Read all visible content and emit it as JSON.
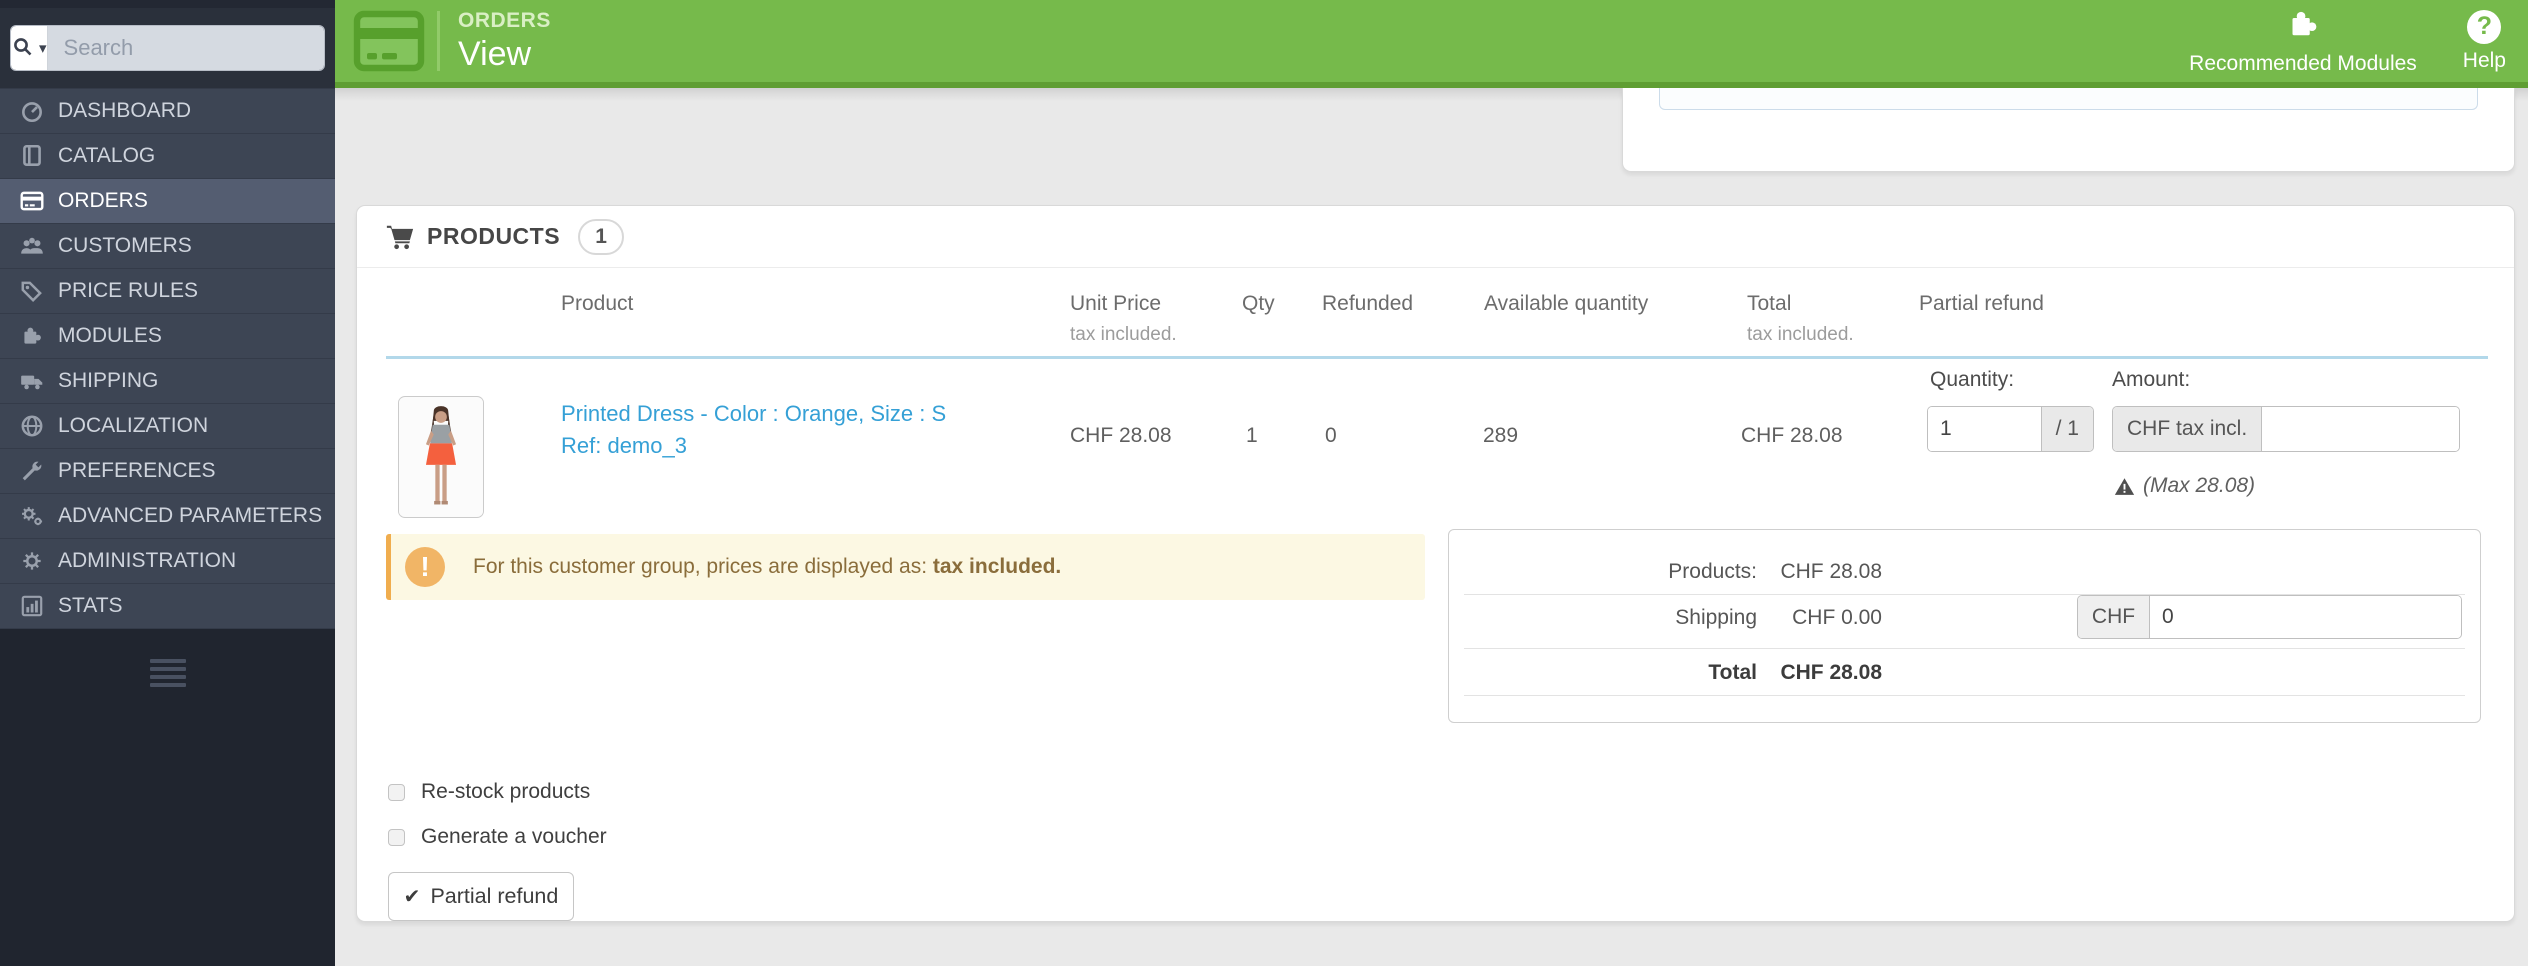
{
  "colors": {
    "green": "#76ba4b",
    "green_dark": "#5f9e33",
    "link": "#35a0d6",
    "sidebar_selected": "#545d71",
    "warn_border": "#f0ad4e",
    "warn_bg": "#fcf8e3",
    "warn_text": "#8a6d3b",
    "underline": "#b2d8ea"
  },
  "sidebar": {
    "search_placeholder": "Search",
    "items": [
      {
        "label": "DASHBOARD"
      },
      {
        "label": "CATALOG"
      },
      {
        "label": "ORDERS"
      },
      {
        "label": "CUSTOMERS"
      },
      {
        "label": "PRICE RULES"
      },
      {
        "label": "MODULES"
      },
      {
        "label": "SHIPPING"
      },
      {
        "label": "LOCALIZATION"
      },
      {
        "label": "PREFERENCES"
      },
      {
        "label": "ADVANCED PARAMETERS"
      },
      {
        "label": "ADMINISTRATION"
      },
      {
        "label": "STATS"
      }
    ]
  },
  "header": {
    "breadcrumb": "ORDERS",
    "title": "View",
    "actions": {
      "recommended_modules": "Recommended Modules",
      "help": "Help",
      "help_glyph": "?"
    }
  },
  "panel": {
    "title": "PRODUCTS",
    "count": "1",
    "table": {
      "headers": {
        "product": "Product",
        "unit_price": "Unit Price",
        "unit_price_note": "tax included.",
        "qty": "Qty",
        "refunded": "Refunded",
        "available": "Available quantity",
        "total": "Total",
        "total_note": "tax included.",
        "partial_refund": "Partial refund"
      },
      "row": {
        "name": "Printed Dress - Color : Orange, Size : S",
        "ref": "Ref: demo_3",
        "unit_price": "CHF 28.08",
        "qty": "1",
        "refunded": "0",
        "available": "289",
        "total": "CHF 28.08"
      }
    },
    "partial_refund": {
      "quantity_label": "Quantity:",
      "quantity_value": "1",
      "quantity_max": "/ 1",
      "amount_label": "Amount:",
      "amount_addon": "CHF tax incl.",
      "amount_value": "",
      "max_note": "(Max 28.08)"
    },
    "alert": {
      "prefix": "For this customer group, prices are displayed as: ",
      "bold": "tax included.",
      "icon_glyph": "!"
    },
    "totals": {
      "products_label": "Products:",
      "products_value": "CHF 28.08",
      "shipping_label": "Shipping",
      "shipping_value": "CHF 0.00",
      "shipping_addon": "CHF",
      "shipping_input": "0",
      "total_label": "Total",
      "total_value": "CHF 28.08"
    },
    "options": [
      {
        "label": "Re-stock products"
      },
      {
        "label": "Generate a voucher"
      }
    ],
    "submit_label": "Partial refund",
    "submit_glyph": "✔"
  }
}
